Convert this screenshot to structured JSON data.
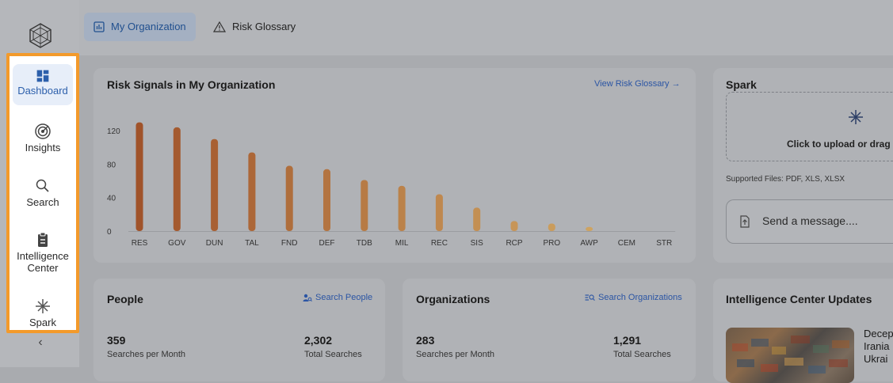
{
  "sidebar": {
    "items": [
      {
        "label": "Dashboard",
        "icon": "dashboard-icon",
        "active": true
      },
      {
        "label": "Insights",
        "icon": "target-icon",
        "active": false
      },
      {
        "label": "Search",
        "icon": "search-icon",
        "active": false
      },
      {
        "label": "Intelligence Center",
        "icon": "clipboard-icon",
        "active": false
      },
      {
        "label": "Spark",
        "icon": "spark-icon",
        "active": false
      }
    ],
    "collapse_glyph": "‹",
    "highlight_color": "#f39a2b"
  },
  "tabs": [
    {
      "label": "My Organization",
      "icon": "bar-chart-icon",
      "active": true
    },
    {
      "label": "Risk Glossary",
      "icon": "warning-icon",
      "active": false
    }
  ],
  "risk_card": {
    "title": "Risk Signals in My Organization",
    "link": "View Risk Glossary →"
  },
  "chart_data": {
    "type": "bar",
    "categories": [
      "RES",
      "GOV",
      "DUN",
      "TAL",
      "FND",
      "DEF",
      "TDB",
      "MIL",
      "REC",
      "SIS",
      "RCP",
      "PRO",
      "AWP",
      "CEM",
      "STR"
    ],
    "values": [
      130,
      124,
      110,
      94,
      78,
      74,
      61,
      54,
      44,
      28,
      12,
      9,
      5,
      0,
      0
    ],
    "title": "Risk Signals in My Organization",
    "ylim": [
      0,
      140
    ],
    "yticks": [
      0,
      40,
      80,
      120
    ],
    "colors": {
      "start": "#a0532a",
      "end": "#d6b06a"
    },
    "grid": false
  },
  "spark": {
    "title": "Spark",
    "upload_text": "Click to upload or drag a",
    "supported": "Supported Files: PDF, XLS, XLSX",
    "message_placeholder": "Send a message...."
  },
  "people": {
    "title": "People",
    "link": "Search People",
    "searches_per_month": "359",
    "searches_per_month_label": "Searches per Month",
    "total_searches": "2,302",
    "total_searches_label": "Total Searches"
  },
  "organizations": {
    "title": "Organizations",
    "link": "Search Organizations",
    "searches_per_month": "283",
    "searches_per_month_label": "Searches per Month",
    "total_searches": "1,291",
    "total_searches_label": "Total Searches"
  },
  "updates": {
    "title": "Intelligence Center Updates",
    "snippet_lines": [
      "Decep",
      "Irania",
      "Ukrai"
    ]
  }
}
